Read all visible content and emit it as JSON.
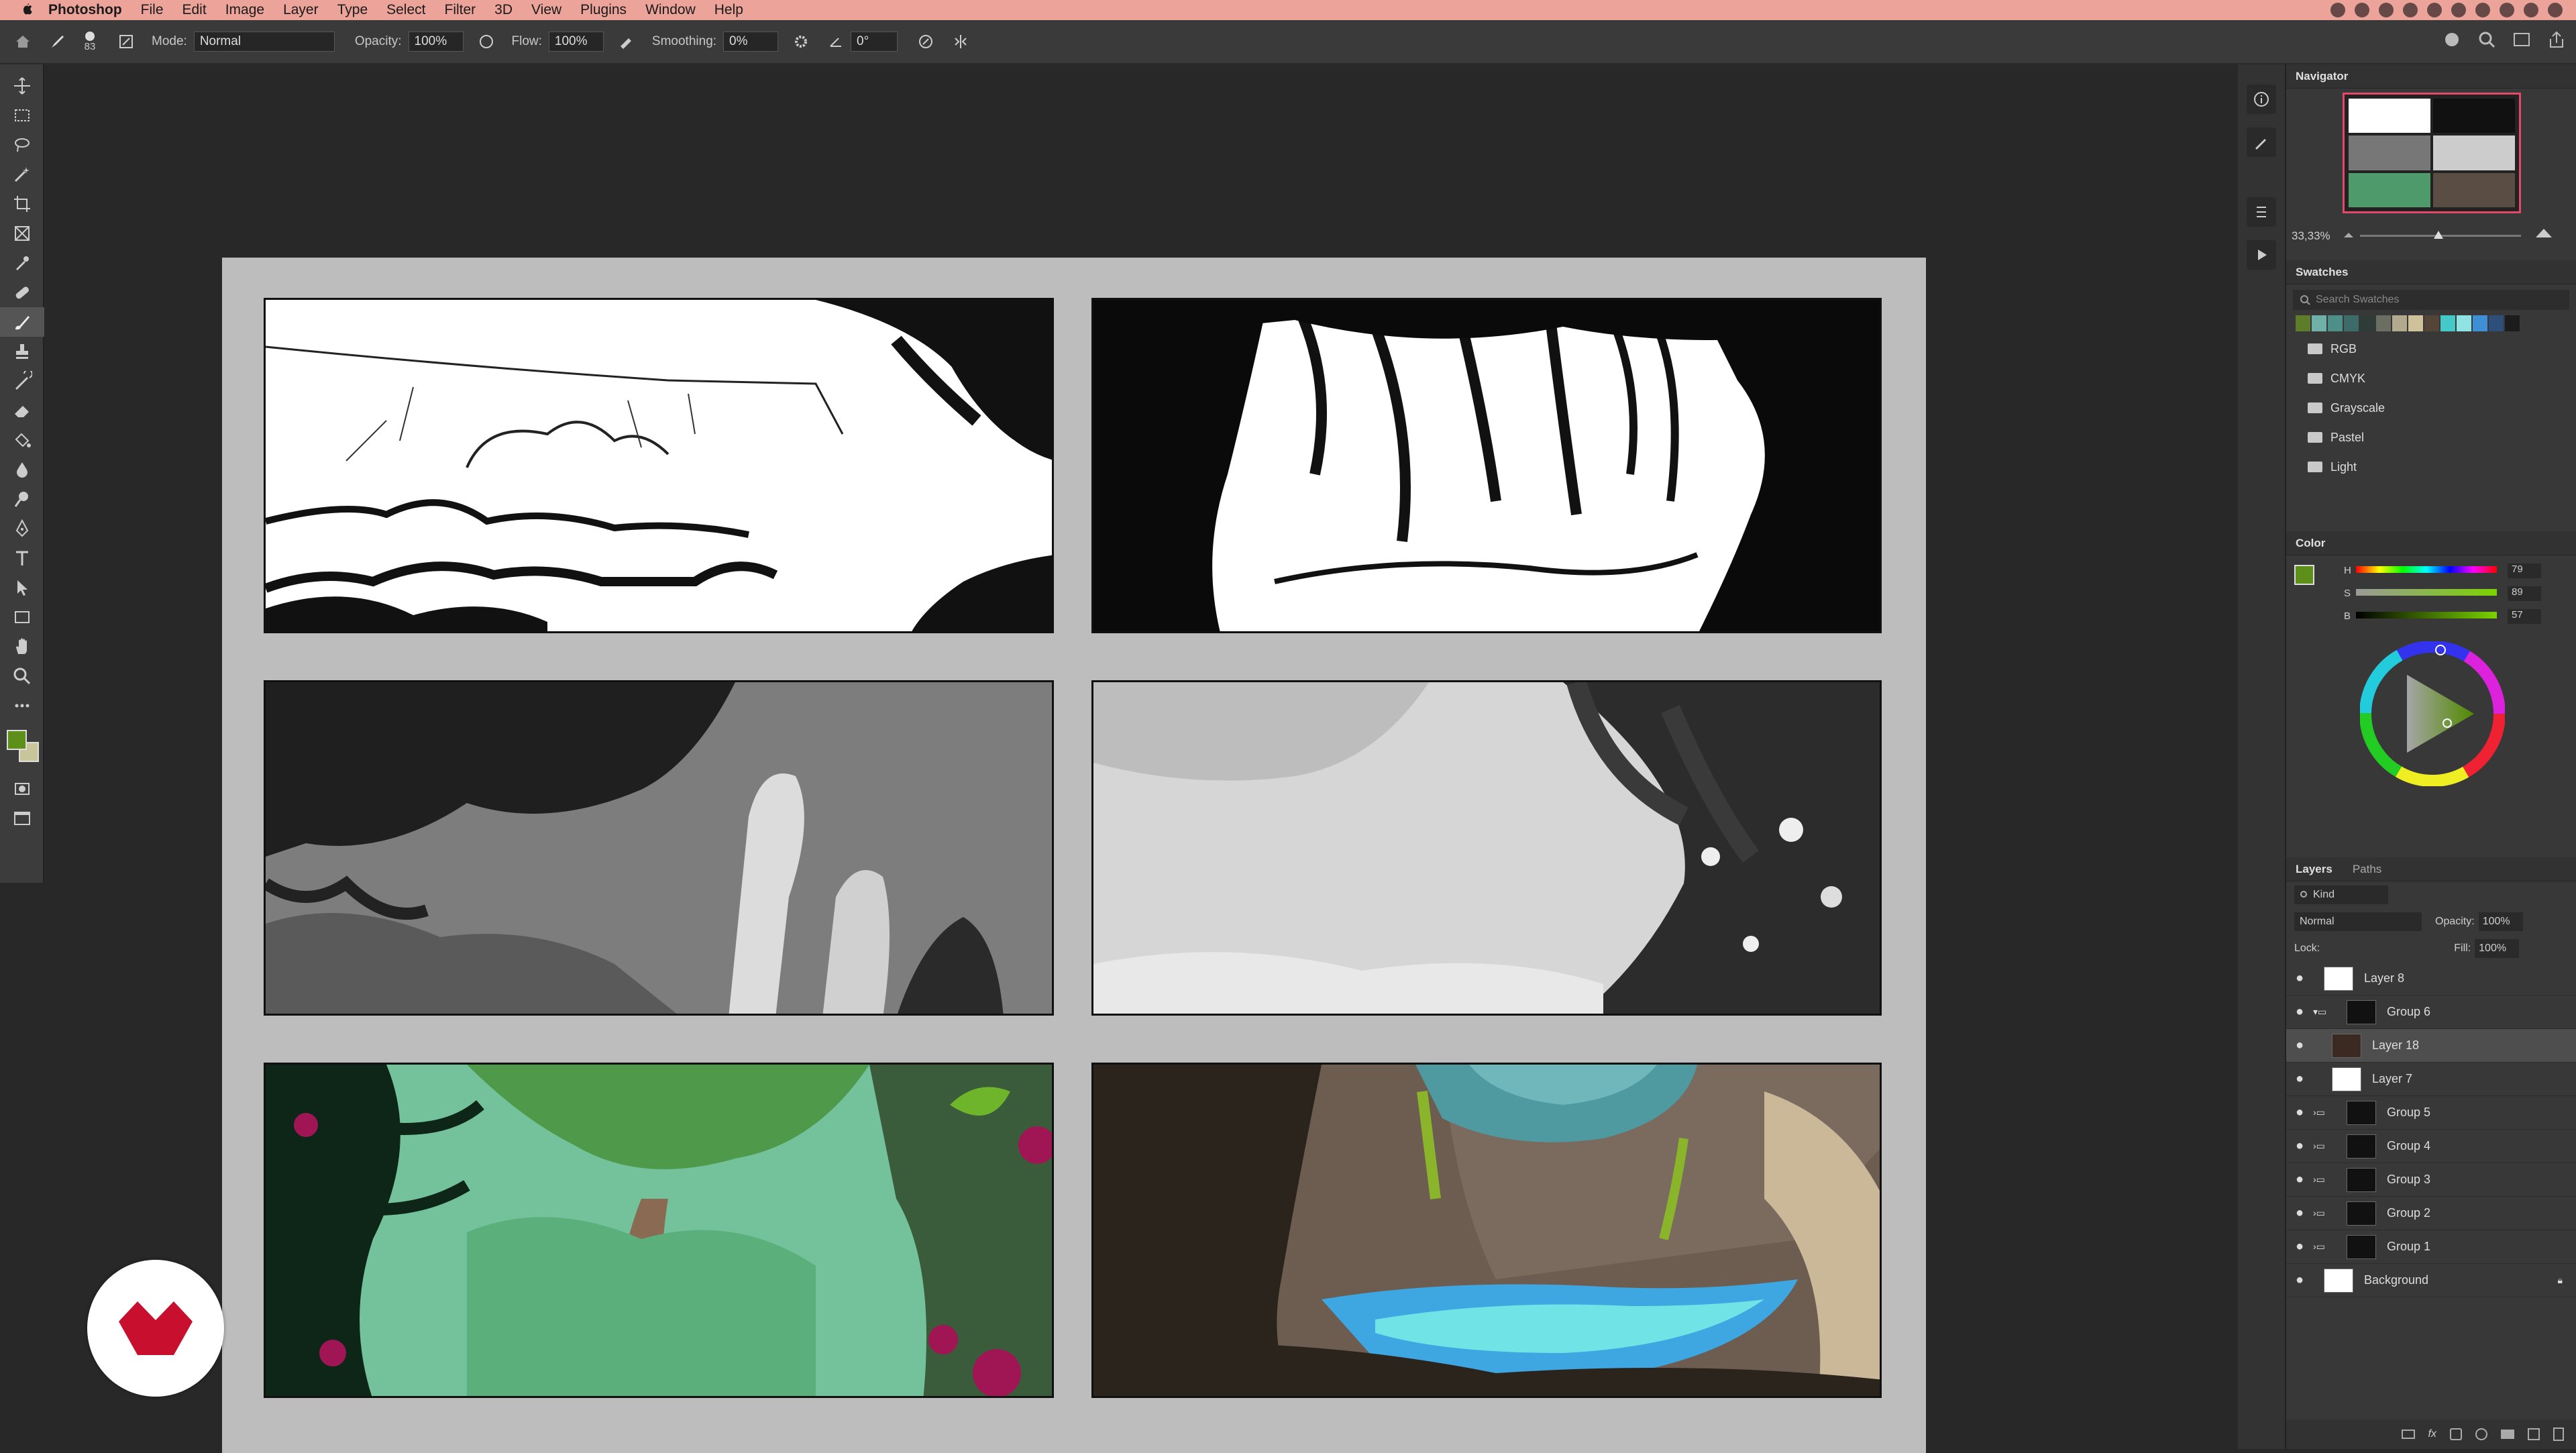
{
  "menubar": {
    "app": "Photoshop",
    "items": [
      "File",
      "Edit",
      "Image",
      "Layer",
      "Type",
      "Select",
      "Filter",
      "3D",
      "View",
      "Plugins",
      "Window",
      "Help"
    ]
  },
  "options": {
    "brush_size": "83",
    "mode_label": "Mode:",
    "mode_value": "Normal",
    "opacity_label": "Opacity:",
    "opacity_value": "100%",
    "flow_label": "Flow:",
    "flow_value": "100%",
    "smoothing_label": "Smoothing:",
    "smoothing_value": "0%",
    "angle_value": "0°"
  },
  "navigator": {
    "title": "Navigator",
    "zoom": "33,33%"
  },
  "swatches": {
    "title": "Swatches",
    "search_placeholder": "Search Swatches",
    "colors": [
      "#5e7d2a",
      "#6fb1a8",
      "#4e8f8a",
      "#3c6b6a",
      "#2f3b36",
      "#6a6f62",
      "#b3a98f",
      "#cfc19a",
      "#554438",
      "#45c8c8",
      "#8fe3e3",
      "#3f8fd6",
      "#2d4f7a",
      "#1c1c1c"
    ],
    "groups": [
      "RGB",
      "CMYK",
      "Grayscale",
      "Pastel",
      "Light"
    ]
  },
  "color": {
    "title": "Color",
    "h_label": "H",
    "h_value": "79",
    "s_label": "S",
    "s_value": "89",
    "b_label": "B",
    "b_value": "57",
    "foreground": "#5e8f1a"
  },
  "layers": {
    "tabs": [
      "Layers",
      "Paths"
    ],
    "kind": "Kind",
    "blend": "Normal",
    "opacity_label": "Opacity:",
    "opacity_value": "100%",
    "lock_label": "Lock:",
    "fill_label": "Fill:",
    "fill_value": "100%",
    "items": [
      "Layer 8",
      "Group 6",
      "Layer 18",
      "Layer 7",
      "Group 5",
      "Group 4",
      "Group 3",
      "Group 2",
      "Group 1",
      "Background"
    ]
  }
}
